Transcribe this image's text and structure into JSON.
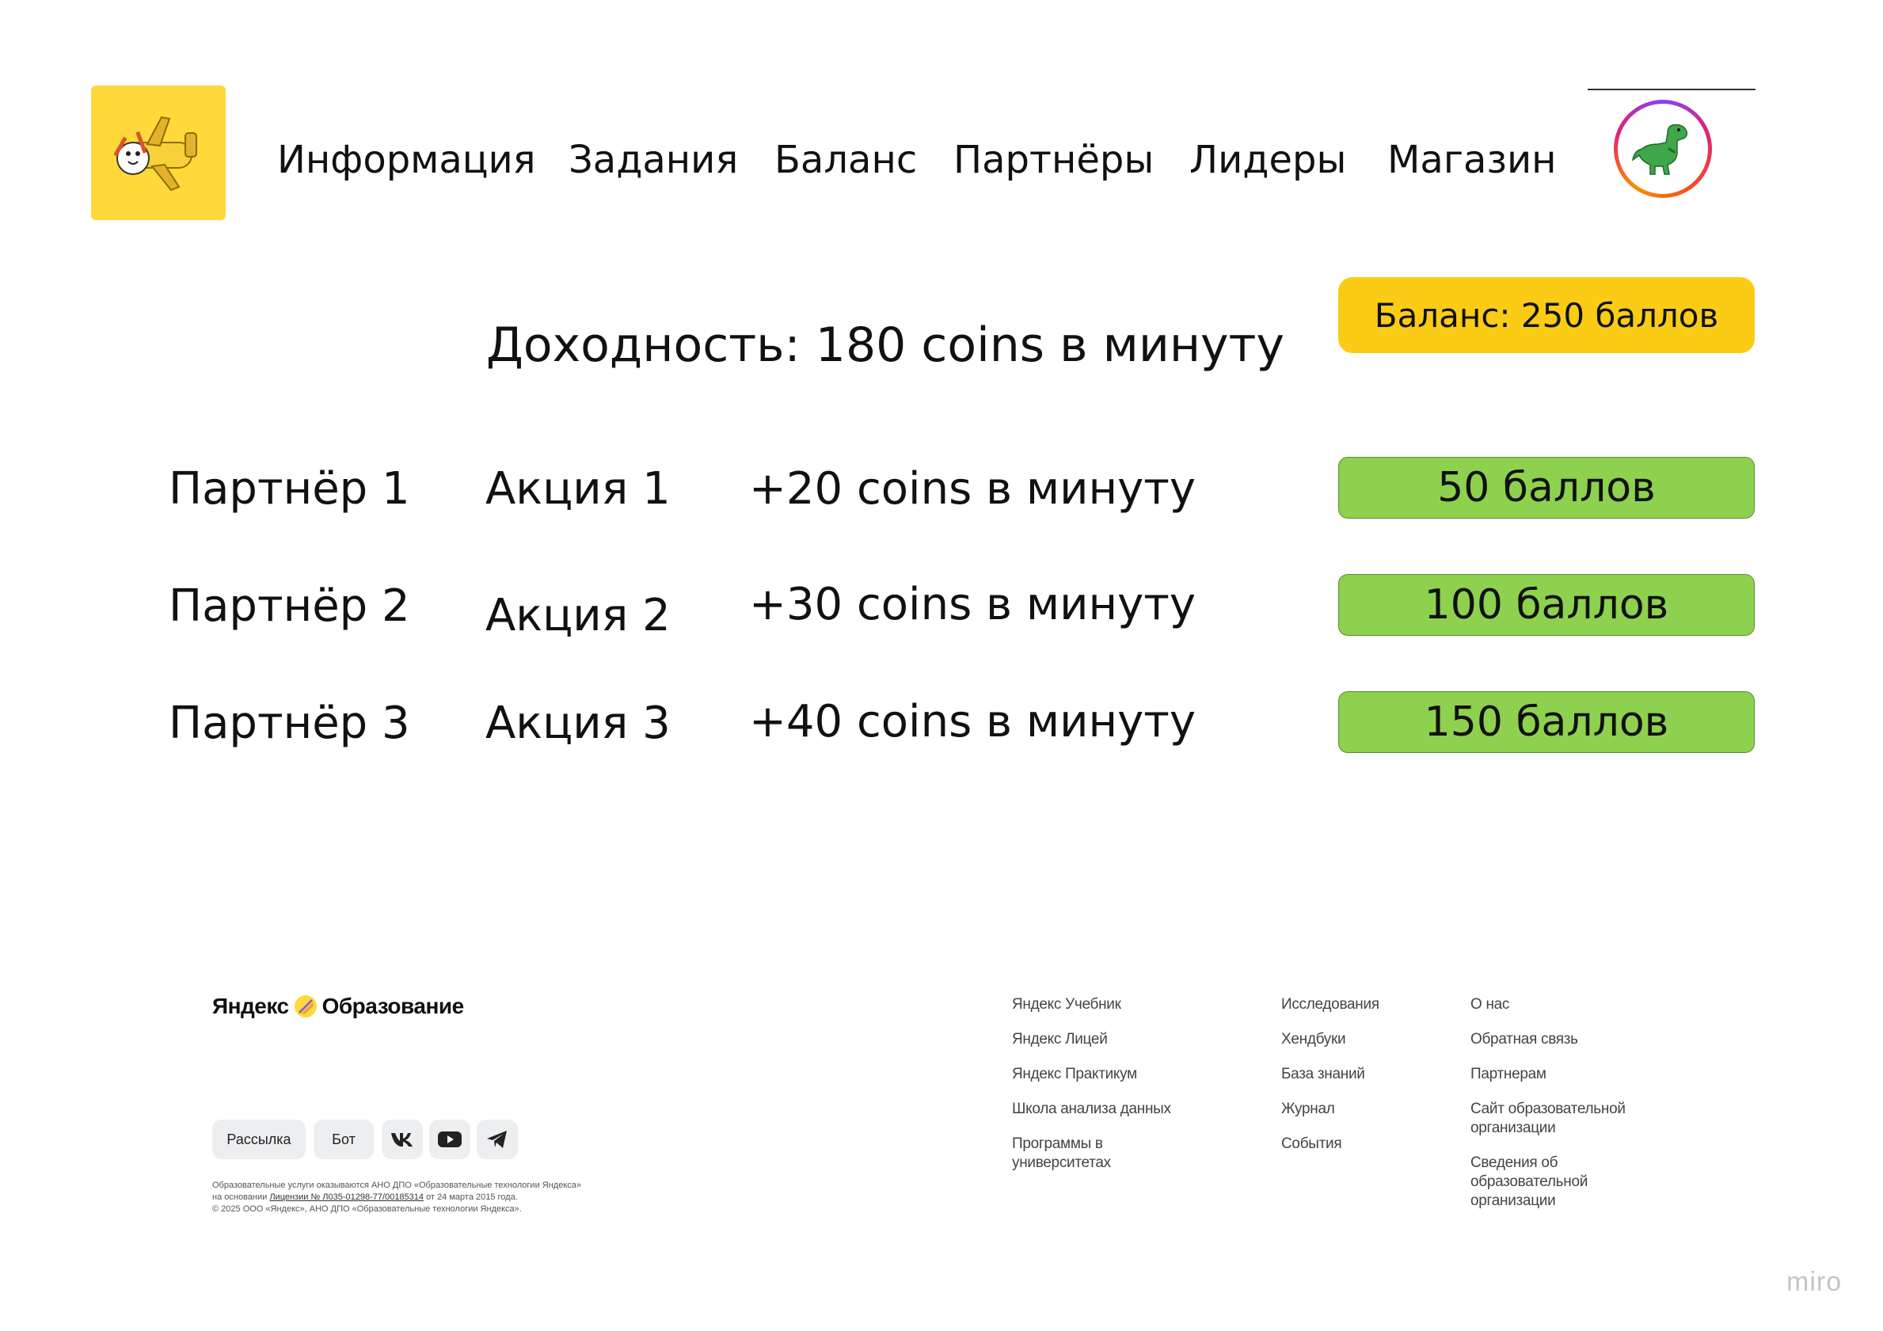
{
  "header": {
    "nav": [
      "Информация",
      "Задания",
      "Баланс",
      "Партнёры",
      "Лидеры",
      "Магазин"
    ]
  },
  "main": {
    "yield_label": "Доходность: 180 coins в минуту",
    "balance_label": "Баланс: 250 баллов",
    "offers": [
      {
        "partner": "Партнёр 1",
        "promo": "Акция 1",
        "bonus": "+20 coins в минуту",
        "price": "50 баллов"
      },
      {
        "partner": "Партнёр 2",
        "promo": "Акция 2",
        "bonus": "+30 coins в минуту",
        "price": "100 баллов"
      },
      {
        "partner": "Партнёр 3",
        "promo": "Акция 3",
        "bonus": "+40 coins в минуту",
        "price": "150 баллов"
      }
    ]
  },
  "footer": {
    "brand_left": "Яндекс",
    "brand_right": "Образование",
    "subscribe_label": "Рассылка",
    "bot_label": "Бот",
    "social_icons": [
      "vk-icon",
      "youtube-icon",
      "telegram-icon"
    ],
    "legal_line1": "Образовательные услуги оказываются АНО ДПО «Образовательные технологии Яндекса»",
    "legal_line2_prefix": "на основании",
    "legal_line2_link": "Лицензии № Л035-01298-77/00185314",
    "legal_line2_suffix": "от 24 марта 2015 года.",
    "legal_line3": "© 2025 ООО «Яндекс», АНО ДПО «Образовательные технологии Яндекса».",
    "col1": [
      "Яндекс Учебник",
      "Яндекс Лицей",
      "Яндекс Практикум",
      "Школа анализа данных",
      "Программы в",
      "университетах"
    ],
    "col2": [
      "Исследования",
      "Хендбуки",
      "База знаний",
      "Журнал",
      "События"
    ],
    "col3": [
      "О нас",
      "Обратная связь",
      "Партнерам",
      "Сайт образовательной",
      "организации",
      "Сведения об",
      "образовательной",
      "организации"
    ]
  },
  "watermark": "miro",
  "colors": {
    "logo_bg": "#FFD93A",
    "balance_bg": "#FACC15",
    "price_bg": "#8ED14E"
  }
}
